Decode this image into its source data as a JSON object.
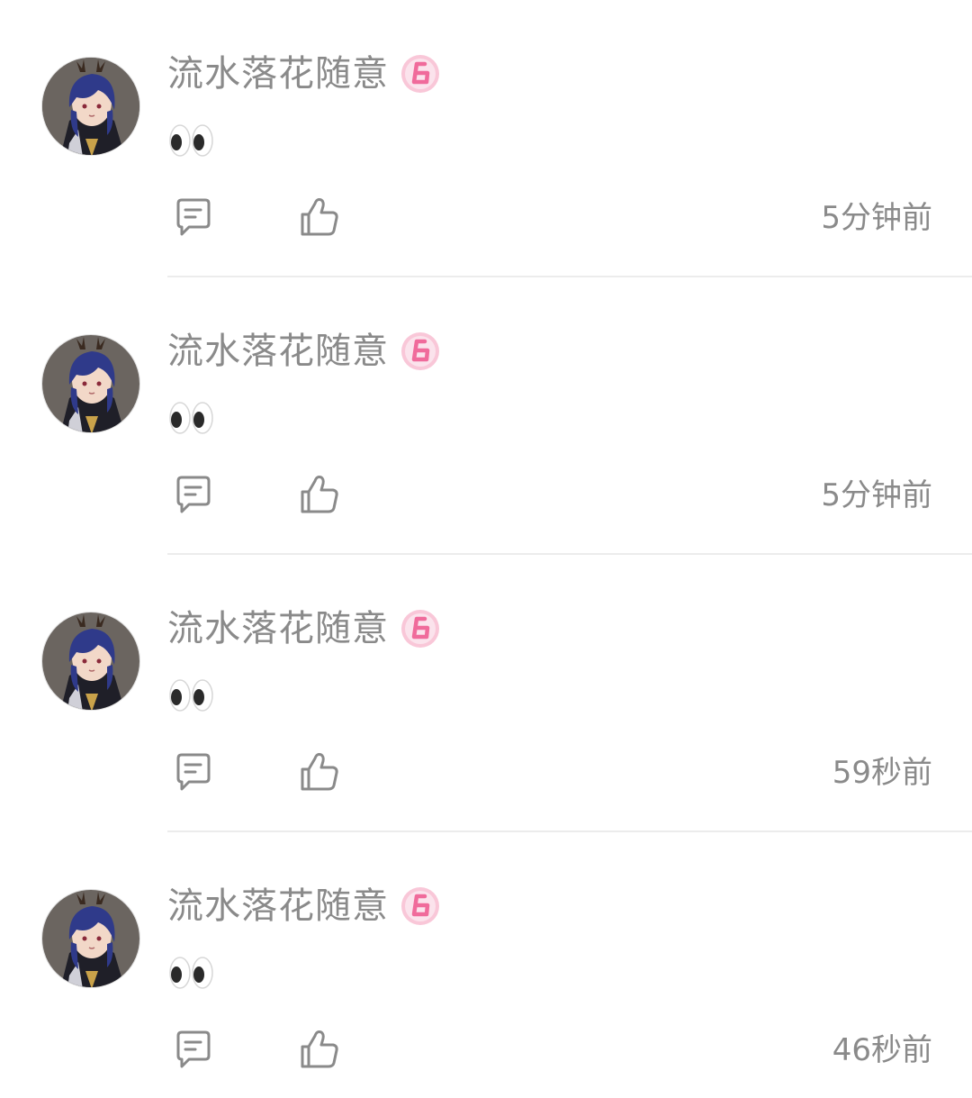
{
  "comments": [
    {
      "username": "流水落花随意",
      "level": "6",
      "content_emoji": "eyes",
      "time": "5分钟前"
    },
    {
      "username": "流水落花随意",
      "level": "6",
      "content_emoji": "eyes",
      "time": "5分钟前"
    },
    {
      "username": "流水落花随意",
      "level": "6",
      "content_emoji": "eyes",
      "time": "59秒前"
    },
    {
      "username": "流水落花随意",
      "level": "6",
      "content_emoji": "eyes",
      "time": "46秒前"
    }
  ],
  "icons": {
    "reply": "reply-bubble-icon",
    "like": "thumbs-up-icon",
    "badge": "level-6-badge-icon"
  },
  "colors": {
    "text_secondary": "#8a8a8a",
    "badge_pink": "#f38fb0",
    "divider": "#ececec"
  }
}
